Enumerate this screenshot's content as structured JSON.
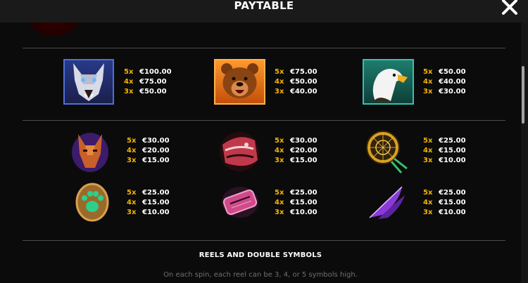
{
  "header": {
    "title": "PAYTABLE"
  },
  "rows": [
    [
      {
        "symbol": "wolf",
        "payouts": [
          {
            "k": "5x",
            "v": "€100.00"
          },
          {
            "k": "4x",
            "v": "€75.00"
          },
          {
            "k": "3x",
            "v": "€50.00"
          }
        ]
      },
      {
        "symbol": "bear",
        "payouts": [
          {
            "k": "5x",
            "v": "€75.00"
          },
          {
            "k": "4x",
            "v": "€50.00"
          },
          {
            "k": "3x",
            "v": "€40.00"
          }
        ]
      },
      {
        "symbol": "eagle",
        "payouts": [
          {
            "k": "5x",
            "v": "€50.00"
          },
          {
            "k": "4x",
            "v": "€40.00"
          },
          {
            "k": "3x",
            "v": "€30.00"
          }
        ]
      }
    ],
    [
      {
        "symbol": "fox-mask",
        "payouts": [
          {
            "k": "5x",
            "v": "€30.00"
          },
          {
            "k": "4x",
            "v": "€20.00"
          },
          {
            "k": "3x",
            "v": "€15.00"
          }
        ]
      },
      {
        "symbol": "totem-head",
        "payouts": [
          {
            "k": "5x",
            "v": "€30.00"
          },
          {
            "k": "4x",
            "v": "€20.00"
          },
          {
            "k": "3x",
            "v": "€15.00"
          }
        ]
      },
      {
        "symbol": "dreamcatcher",
        "payouts": [
          {
            "k": "5x",
            "v": "€25.00"
          },
          {
            "k": "4x",
            "v": "€15.00"
          },
          {
            "k": "3x",
            "v": "€10.00"
          }
        ]
      }
    ],
    [
      {
        "symbol": "paw-stone",
        "payouts": [
          {
            "k": "5x",
            "v": "€25.00"
          },
          {
            "k": "4x",
            "v": "€15.00"
          },
          {
            "k": "3x",
            "v": "€10.00"
          }
        ]
      },
      {
        "symbol": "bracelet",
        "payouts": [
          {
            "k": "5x",
            "v": "€25.00"
          },
          {
            "k": "4x",
            "v": "€15.00"
          },
          {
            "k": "3x",
            "v": "€10.00"
          }
        ]
      },
      {
        "symbol": "feather",
        "payouts": [
          {
            "k": "5x",
            "v": "€25.00"
          },
          {
            "k": "4x",
            "v": "€15.00"
          },
          {
            "k": "3x",
            "v": "€10.00"
          }
        ]
      }
    ]
  ],
  "section": {
    "title": "REELS AND DOUBLE SYMBOLS",
    "text": "On each spin, each reel can be 3, 4, or 5 symbols high."
  },
  "colors": {
    "accent": "#f5b400",
    "muted": "#707070"
  }
}
